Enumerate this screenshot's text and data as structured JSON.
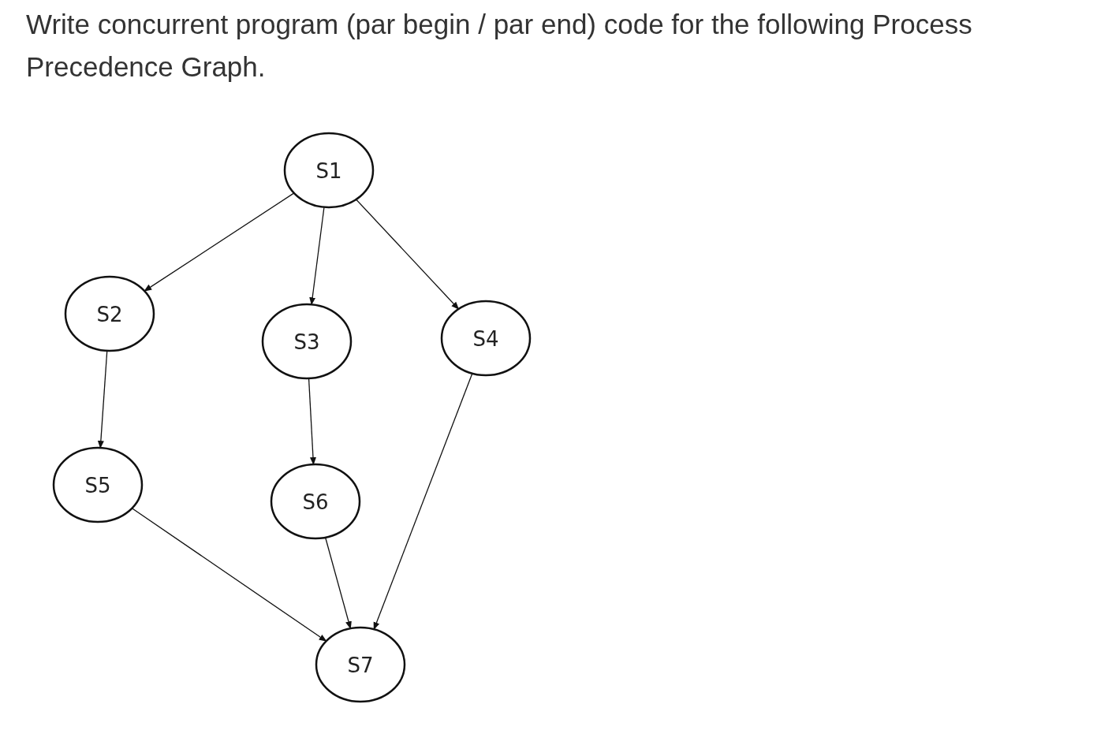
{
  "question": "Write concurrent program (par begin / par end) code for the following Process Precedence Graph.",
  "graph": {
    "nodes": [
      {
        "label": "S1"
      },
      {
        "label": "S2"
      },
      {
        "label": "S3"
      },
      {
        "label": "S4"
      },
      {
        "label": "S5"
      },
      {
        "label": "S6"
      },
      {
        "label": "S7"
      }
    ]
  }
}
